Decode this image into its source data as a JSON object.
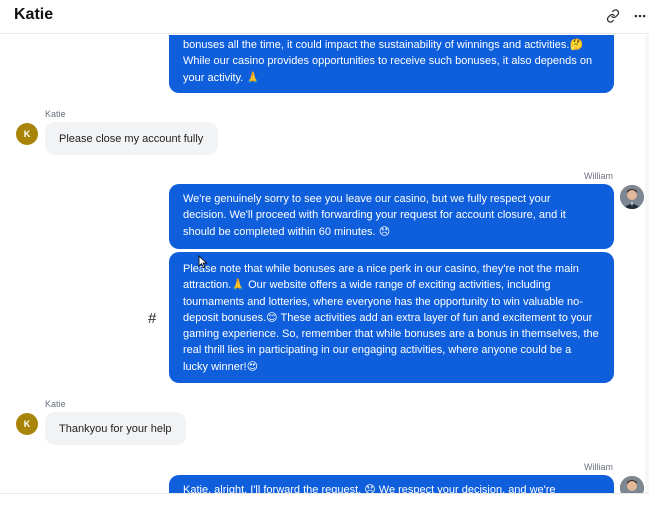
{
  "header": {
    "title": "Katie",
    "icons": [
      "link-icon",
      "more-horizontal-icon"
    ]
  },
  "messages": [
    {
      "id": "m0",
      "sender": "",
      "direction": "out",
      "lines": [
        "bonuses all the time, it could impact the sustainability of winnings and activities.",
        "While our casino provides opportunities to receive such bonuses, it also depends on",
        "your activity."
      ],
      "emojis": [
        "🤔",
        "🙏"
      ]
    },
    {
      "id": "m1",
      "sender": "Katie",
      "direction": "in",
      "avatar_letter": "K",
      "text": "Please close my account fully"
    },
    {
      "id": "m2",
      "sender": "William",
      "direction": "out",
      "lines": [
        "We're genuinely sorry to see you leave our casino, but we fully respect your",
        "decision. We'll proceed with forwarding your request for account closure, and it",
        "should be completed within 60 minutes."
      ],
      "emojis": [
        "😞"
      ]
    },
    {
      "id": "m3",
      "sender": "",
      "direction": "out",
      "lines": [
        "Please note that while bonuses are a nice perk in our casino, they're not the main",
        "attraction.",
        "Our website offers a wide range of exciting activities, including",
        "tournaments and lotteries, where everyone has the opportunity to win valuable no-",
        "deposit bonuses.",
        "These activities add an extra layer of fun and excitement to your",
        "gaming experience. So, remember that while bonuses are a bonus in themselves, the",
        "real thrill lies in participating in our engaging activities, where anyone could be a",
        "lucky winner!"
      ],
      "emojis": [
        "🙏",
        "😊",
        "😍"
      ],
      "marker": "#"
    },
    {
      "id": "m4",
      "sender": "Katie",
      "direction": "in",
      "avatar_letter": "K",
      "text": "Thankyou for your help"
    },
    {
      "id": "m5",
      "sender": "William",
      "direction": "out",
      "lines": [
        "Katie, alright, I'll forward the request.",
        "We respect your decision, and we're"
      ],
      "emojis": [
        "😞"
      ]
    }
  ]
}
